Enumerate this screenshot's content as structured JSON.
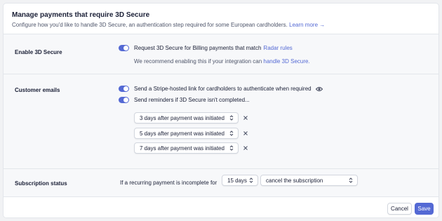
{
  "header": {
    "title": "Manage payments that require 3D Secure",
    "description": "Configure how you'd like to handle 3D Secure, an authentication step required for some European cardholders.",
    "learn_more": "Learn more"
  },
  "enable_3ds": {
    "label": "Enable 3D Secure",
    "toggle_text": "Request 3D Secure for Billing payments that match",
    "radar_link": "Radar rules",
    "note": "We recommend enabling this if your integration can",
    "note_link": "handle 3D Secure."
  },
  "customer_emails": {
    "label": "Customer emails",
    "option1": "Send a Stripe-hosted link for cardholders to authenticate when required",
    "option2": "Send reminders if 3D Secure isn't completed...",
    "reminders": [
      "3 days after payment was initiated",
      "5 days after payment was initiated",
      "7 days after payment was initiated"
    ]
  },
  "subscription_status": {
    "label": "Subscription status",
    "prefix": "If a recurring payment is incomplete for",
    "days_value": "15 days",
    "action_value": "cancel the subscription"
  },
  "footer": {
    "cancel": "Cancel",
    "save": "Save"
  },
  "colors": {
    "accent": "#5469d4"
  },
  "icons": {
    "toggle": "toggle-on-icon",
    "eye": "eye-icon",
    "chevron": "chevron-updown-icon",
    "remove": "close-icon",
    "arrow": "arrow-right-icon"
  }
}
